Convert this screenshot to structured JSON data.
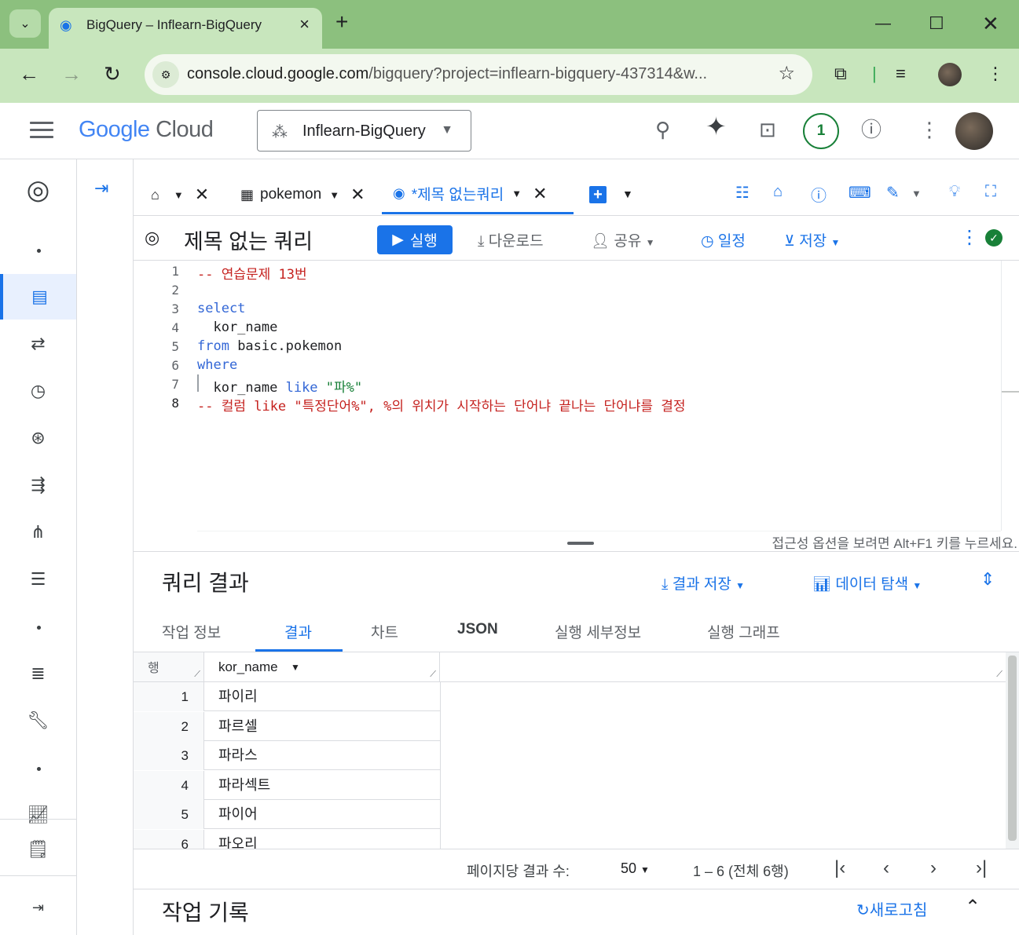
{
  "browser": {
    "tab_title": "BigQuery – Inflearn-BigQuery",
    "url_main": "console.cloud.google.com",
    "url_rest": "/bigquery?project=inflearn-bigquery-437314&w..."
  },
  "cloud_header": {
    "logo_google": "Google",
    "logo_cloud": "Cloud",
    "project_name": "Inflearn-BigQuery",
    "notification_count": "1"
  },
  "query_tabs": [
    {
      "label": "pokemon"
    },
    {
      "label": "*제목 없는쿼리"
    }
  ],
  "editor_bar": {
    "title": "제목 없는 쿼리",
    "run": "실행",
    "download": "다운로드",
    "share": "공유",
    "schedule": "일정",
    "save": "저장"
  },
  "editor": {
    "line_numbers": [
      "1",
      "2",
      "3",
      "4",
      "5",
      "6",
      "7",
      "8"
    ],
    "l1": "-- 연습문제 13번",
    "l3_kw": "select",
    "l4": "  kor_name",
    "l5_kw": "from",
    "l5_rest": " basic.pokemon",
    "l6_kw": "where",
    "l7_pre": "  kor_name ",
    "l7_kw": "like",
    "l7_str": " \"파%\"",
    "l8": "-- 컬럼 like \"특정단어%\", %의 위치가 시작하는 단어냐 끝나는 단어냐를 결정",
    "a11y_hint": "접근성 옵션을 보려면 Alt+F1 키를 누르세요."
  },
  "results": {
    "title": "쿼리 결과",
    "save_results": "결과 저장",
    "explore_data": "데이터 탐색",
    "tabs": [
      "작업 정보",
      "결과",
      "차트",
      "JSON",
      "실행 세부정보",
      "실행 그래프"
    ],
    "col_row": "행",
    "col_name": "kor_name",
    "rows": [
      {
        "n": "1",
        "v": "파이리"
      },
      {
        "n": "2",
        "v": "파르셀"
      },
      {
        "n": "3",
        "v": "파라스"
      },
      {
        "n": "4",
        "v": "파라섹트"
      },
      {
        "n": "5",
        "v": "파이어"
      },
      {
        "n": "6",
        "v": "파오리"
      }
    ]
  },
  "pager": {
    "per_page_label": "페이지당 결과 수:",
    "per_page": "50",
    "range": "1 – 6 (전체 6행)"
  },
  "job_history": {
    "title": "작업 기록",
    "refresh": "새로고침"
  }
}
